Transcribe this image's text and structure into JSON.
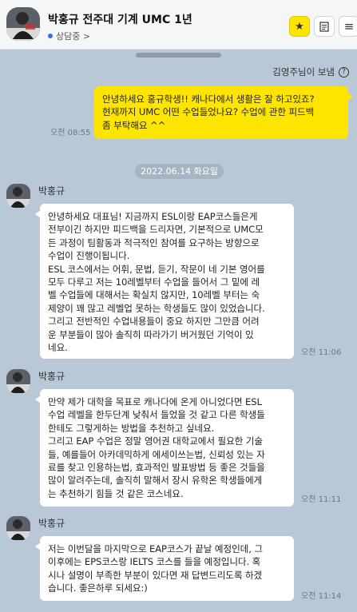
{
  "header": {
    "title": "박홍규 전주대 기계 UMC 1년",
    "status": "상담중 >",
    "star_icon": "star-icon",
    "doc_icon": "document-icon",
    "menu_icon": "menu-icon"
  },
  "sender_note": "김영주님이 보냄",
  "messages": {
    "mine": {
      "text": "안녕하세요 홍규학생!! 캐나다에서 생활은 잘 하고있죠?\n현재까지 UMC 어떤 수업들었나요? 수업에 관한 피드백\n좀 부탁해요 ^^",
      "time": "오전 08:55"
    },
    "date": "2022.06.14 화요일",
    "m1": {
      "name": "박홍규",
      "text": "안녕하세요 대표님! 지금까지 ESL이랑 EAP코스들은게\n전부이긴 하지만 피드백을 드리자면, 기본적으로 UMC모\n든 과정이 팀활동과 적극적인 참여를 요구하는 방향으로\n수업이 진행이됩니다.\nESL 코스에서는 어휘, 문법, 듣기, 작문이 네 기본 영어를\n모두 다루고 저는 10레벨부터 수업을 들어서 그 밑에 레\n벨 수업들에 대해서는 확실치 않지만, 10레벨 부터는 숙\n제양이 꽤 많고 레벨업 못하는 학생들도 많이 있었습니다.\n그리고 전반적인 수업내용들이 중요 하지만 그만큼 어려\n운 부분들이 많아 솔직히 따라가기 버거웠던 기억이 있\n네요.",
      "time": "오전 11:06"
    },
    "m2": {
      "name": "박홍규",
      "text": "만약 제가 대학을 목표로 캐나다에 온게 아니었다면 ESL\n수업 레벨을 한두단계 낮춰서 들었을 것 같고 다른 학생들\n한테도 그렇게하는 방법을 추천하고 싶네요.\n그리고 EAP 수업은 정말 영어권 대학교에서 필요한 기술\n들, 예를들어 아카데믹하게 에세이쓰는법, 신뢰성 있는 자\n료를 찾고 인용하는법, 효과적인 발표방법 등 좋은 것들을\n많이 알려주는데, 솔직히 말해서 장시 유학온 학생들에게\n는 추천하기 힘들 것 같은 코스네요.",
      "time": "오전 11:11"
    },
    "m3": {
      "name": "박홍규",
      "text": "저는 이번달을 마지막으로 EAP코스가 끝날 예정인데, 그\n이후에는 EPS코스랑 IELTS 코스를 들을 예정입니다. 혹\n시나 설명이 부족한 부분이 있다면 재 답변드리도록 하겠\n습니다. 좋은하루 되세요:)",
      "time": "오전 11:14"
    }
  },
  "colors": {
    "background": "#b9c8d6",
    "my_bubble": "#fee500",
    "their_bubble": "#ffffff",
    "status_dot": "#3a6fd8"
  }
}
